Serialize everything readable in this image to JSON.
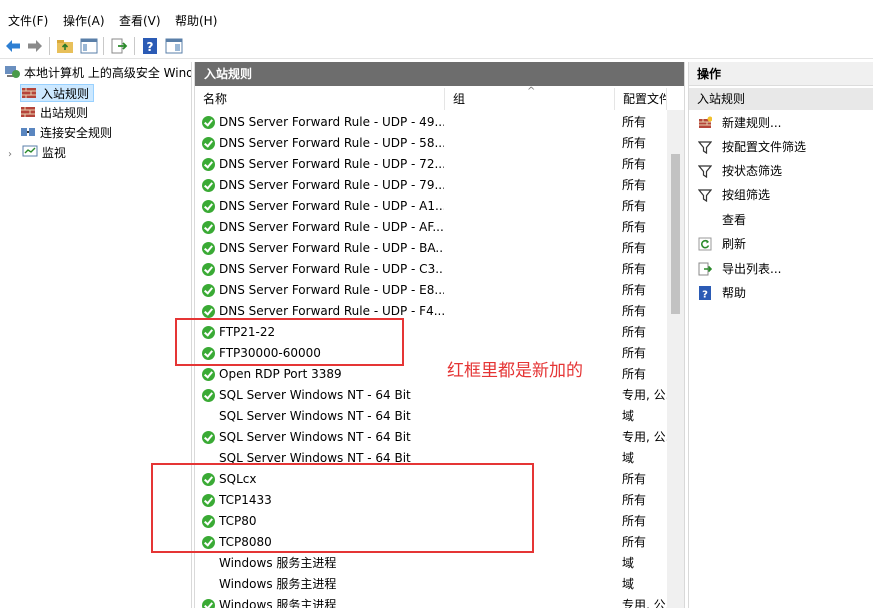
{
  "menu": [
    "文件(F)",
    "操作(A)",
    "查看(V)",
    "帮助(H)"
  ],
  "tree": {
    "root": "本地计算机 上的高级安全 Wind",
    "items": [
      "入站规则",
      "出站规则",
      "连接安全规则",
      "监视"
    ]
  },
  "center": {
    "title": "入站规则",
    "columns": [
      "名称",
      "组",
      "配置文件"
    ],
    "rows": [
      {
        "name": "DNS Server Forward Rule - UDP - 49...",
        "profile": "所有",
        "enabled": true
      },
      {
        "name": "DNS Server Forward Rule - UDP - 58...",
        "profile": "所有",
        "enabled": true
      },
      {
        "name": "DNS Server Forward Rule - UDP - 72...",
        "profile": "所有",
        "enabled": true
      },
      {
        "name": "DNS Server Forward Rule - UDP - 79...",
        "profile": "所有",
        "enabled": true
      },
      {
        "name": "DNS Server Forward Rule - UDP - A1...",
        "profile": "所有",
        "enabled": true
      },
      {
        "name": "DNS Server Forward Rule - UDP - AF...",
        "profile": "所有",
        "enabled": true
      },
      {
        "name": "DNS Server Forward Rule - UDP - BA...",
        "profile": "所有",
        "enabled": true
      },
      {
        "name": "DNS Server Forward Rule - UDP - C3...",
        "profile": "所有",
        "enabled": true
      },
      {
        "name": "DNS Server Forward Rule - UDP - E8...",
        "profile": "所有",
        "enabled": true
      },
      {
        "name": "DNS Server Forward Rule - UDP - F4...",
        "profile": "所有",
        "enabled": true
      },
      {
        "name": "FTP21-22",
        "profile": "所有",
        "enabled": true
      },
      {
        "name": "FTP30000-60000",
        "profile": "所有",
        "enabled": true
      },
      {
        "name": "Open RDP Port 3389",
        "profile": "所有",
        "enabled": true
      },
      {
        "name": "SQL Server Windows NT - 64 Bit",
        "profile": "专用, 公...",
        "enabled": true
      },
      {
        "name": "SQL Server Windows NT - 64 Bit",
        "profile": "域",
        "enabled": false
      },
      {
        "name": "SQL Server Windows NT - 64 Bit",
        "profile": "专用, 公...",
        "enabled": true
      },
      {
        "name": "SQL Server Windows NT - 64 Bit",
        "profile": "域",
        "enabled": false
      },
      {
        "name": "SQLcx",
        "profile": "所有",
        "enabled": true
      },
      {
        "name": "TCP1433",
        "profile": "所有",
        "enabled": true
      },
      {
        "name": "TCP80",
        "profile": "所有",
        "enabled": true
      },
      {
        "name": "TCP8080",
        "profile": "所有",
        "enabled": true
      },
      {
        "name": "Windows 服务主进程",
        "profile": "域",
        "enabled": false
      },
      {
        "name": "Windows 服务主进程",
        "profile": "域",
        "enabled": false
      },
      {
        "name": "Windows 服务主进程",
        "profile": "专用, 公...",
        "enabled": true
      }
    ]
  },
  "annotation": "红框里都是新加的",
  "actions": {
    "header": "操作",
    "section": "入站规则",
    "items": [
      {
        "label": "新建规则...",
        "icon": "new-rule-icon"
      },
      {
        "label": "按配置文件筛选",
        "icon": "filter-icon"
      },
      {
        "label": "按状态筛选",
        "icon": "filter-icon"
      },
      {
        "label": "按组筛选",
        "icon": "filter-icon"
      },
      {
        "label": "查看",
        "icon": "view-icon"
      },
      {
        "label": "刷新",
        "icon": "refresh-icon"
      },
      {
        "label": "导出列表...",
        "icon": "export-icon"
      },
      {
        "label": "帮助",
        "icon": "help-icon"
      }
    ]
  },
  "colors": {
    "accent": "#3aaa35",
    "highlight": "#e53535",
    "title_bar": "#6d6d6d"
  }
}
